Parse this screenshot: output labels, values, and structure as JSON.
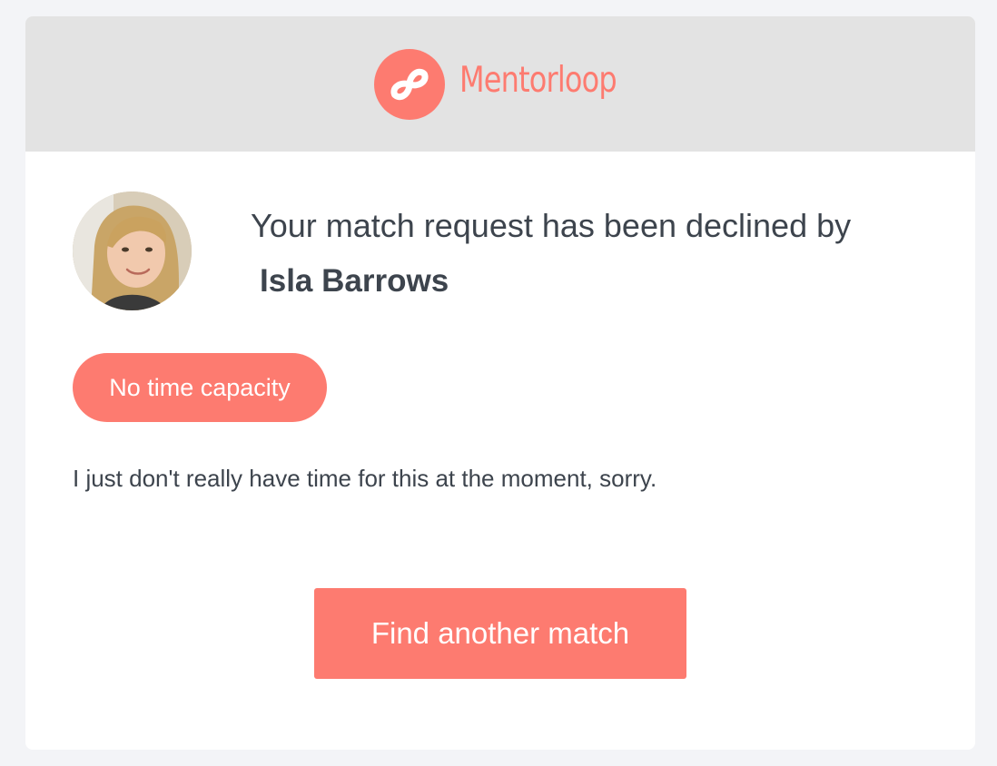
{
  "brand": {
    "name": "Mentorloop",
    "logo_icon": "infinity-loop-icon",
    "accent_color": "#fd7b70",
    "header_background": "#e3e3e3"
  },
  "notification": {
    "headline": "Your match request has been declined by",
    "person_name": "Isla Barrows",
    "avatar": "user-avatar",
    "reason_tag": "No time capacity",
    "message": "I just don't really have time for this at the moment, sorry."
  },
  "actions": {
    "primary_label": "Find another match"
  }
}
